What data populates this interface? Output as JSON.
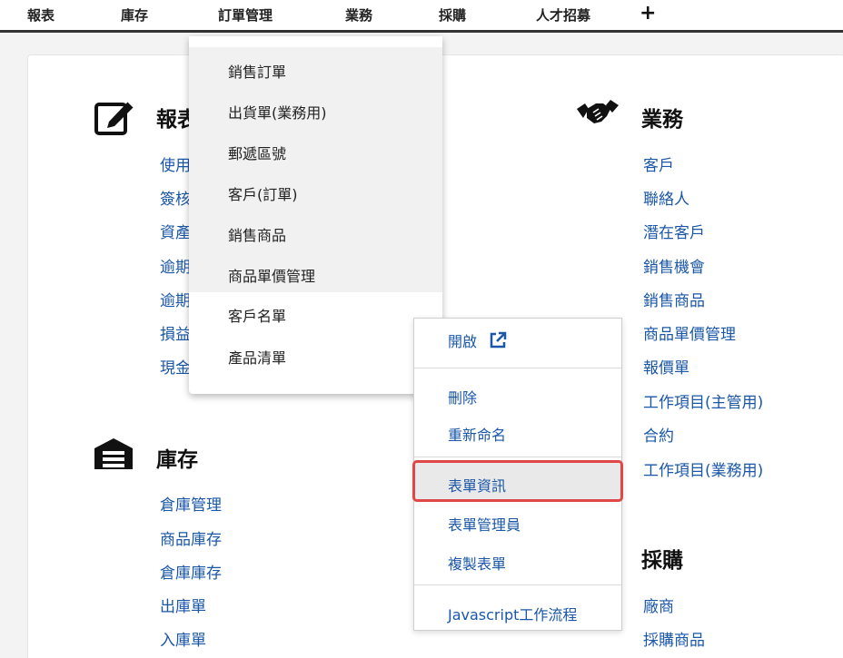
{
  "nav": {
    "items": [
      {
        "label": "報表"
      },
      {
        "label": "庫存"
      },
      {
        "label": "訂單管理"
      },
      {
        "label": "業務"
      },
      {
        "label": "採購"
      },
      {
        "label": "人才招募"
      }
    ],
    "plus": "+"
  },
  "sections": {
    "reports": {
      "title": "報表",
      "icon": "edit-square-icon",
      "links": [
        "使用",
        "簽核",
        "資產",
        "逾期",
        "逾期",
        "損益",
        "現金"
      ]
    },
    "inventory": {
      "title": "庫存",
      "icon": "warehouse-icon",
      "links": [
        "倉庫管理",
        "商品庫存",
        "倉庫庫存",
        "出庫單",
        "入庫單"
      ]
    },
    "sales": {
      "title": "業務",
      "icon": "handshake-icon",
      "links": [
        "客戶",
        "聯絡人",
        "潛在客戶",
        "銷售機會",
        "銷售商品",
        "商品單價管理",
        "報價單",
        "工作項目(主管用)",
        "合約",
        "工作項目(業務用)"
      ]
    },
    "purchasing": {
      "title": "採購",
      "links": [
        "廠商",
        "採購商品"
      ]
    }
  },
  "dropdown": {
    "items": [
      "銷售訂單",
      "出貨單(業務用)",
      "郵遞區號",
      "客戶(訂單)",
      "銷售商品",
      "商品單價管理",
      "客戶名單",
      "產品清單"
    ]
  },
  "context_menu": {
    "open": "開啟",
    "delete": "刪除",
    "rename": "重新命名",
    "form_info": "表單資訊",
    "form_admin": "表單管理員",
    "copy_form": "複製表單",
    "js_workflow": "Javascript工作流程",
    "highlight_color": "#e04848"
  }
}
